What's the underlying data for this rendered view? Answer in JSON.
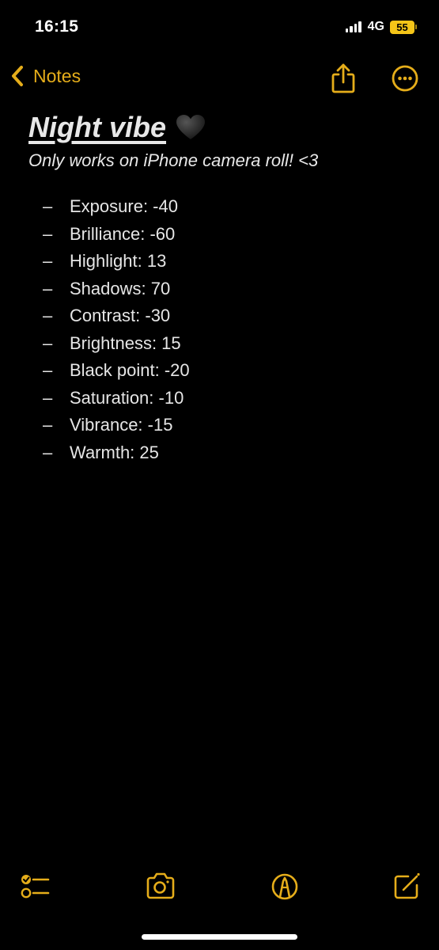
{
  "status_bar": {
    "time": "16:15",
    "network": "4G",
    "battery": "55",
    "icons": [
      "signal-icon",
      "battery-icon"
    ]
  },
  "nav": {
    "back_label": "Notes",
    "icons": [
      "chevron-left-icon",
      "share-icon",
      "more-icon"
    ]
  },
  "note": {
    "title": "Night vibe",
    "title_emoji": "black-heart-icon",
    "subtitle": "Only works on iPhone camera roll! <3",
    "bullet": "–",
    "items": [
      {
        "label": "Exposure: -40"
      },
      {
        "label": "Brilliance: -60"
      },
      {
        "label": "Highlight: 13"
      },
      {
        "label": "Shadows: 70"
      },
      {
        "label": "Contrast: -30"
      },
      {
        "label": "Brightness: 15"
      },
      {
        "label": "Black point: -20"
      },
      {
        "label": "Saturation: -10"
      },
      {
        "label": "Vibrance: -15"
      },
      {
        "label": "Warmth: 25"
      }
    ]
  },
  "toolbar": {
    "icons": [
      "checklist-icon",
      "camera-icon",
      "markup-icon",
      "compose-icon"
    ]
  },
  "colors": {
    "accent": "#e5ad1a",
    "background": "#000000",
    "text": "#e6e6e6",
    "battery": "#f5c518"
  }
}
